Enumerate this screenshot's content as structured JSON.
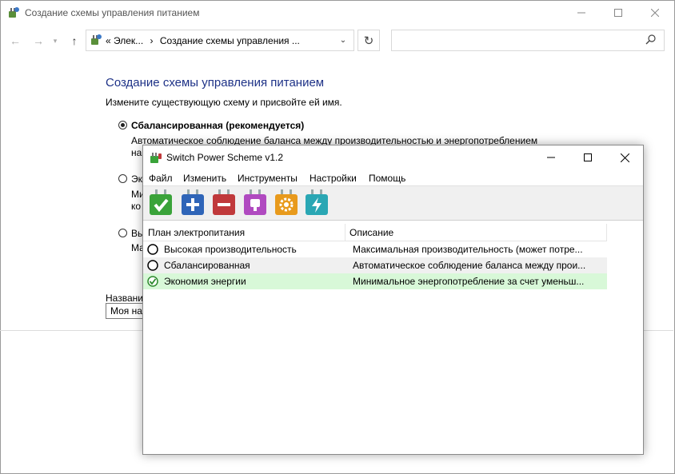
{
  "background_window": {
    "title": "Создание схемы управления питанием",
    "address_bar": {
      "chevron": "«",
      "crumb_1": "Элек...",
      "separator": "›",
      "crumb_2": "Создание схемы управления ..."
    },
    "search_placeholder": "",
    "heading": "Создание схемы управления питанием",
    "subheading": "Измените существующую схему и присвойте ей имя.",
    "options": [
      {
        "label": "Сбалансированная (рекомендуется)",
        "selected": true,
        "desc_line1": "Автоматическое соблюдение баланса между производительностью и энергопотреблением",
        "desc_line2": "на"
      },
      {
        "label": "Эк",
        "selected": false,
        "desc_line1": "Ми",
        "desc_line2": "ко"
      },
      {
        "label": "Вы",
        "selected": false,
        "desc_line1": "Ма"
      }
    ],
    "name_label": "Названи",
    "name_value": "Моя на"
  },
  "app": {
    "title": "Switch Power Scheme v1.2",
    "menu": [
      "Файл",
      "Изменить",
      "Инструменты",
      "Настройки",
      "Помощь"
    ],
    "toolbar_icons": [
      {
        "name": "activate",
        "color": "#3aa33a",
        "glyph": "check"
      },
      {
        "name": "add",
        "color": "#2f65b8",
        "glyph": "plus"
      },
      {
        "name": "remove",
        "color": "#c0393b",
        "glyph": "minus"
      },
      {
        "name": "plug",
        "color": "#b04ac0",
        "glyph": "plug"
      },
      {
        "name": "settings",
        "color": "#e89a1c",
        "glyph": "gear"
      },
      {
        "name": "power",
        "color": "#2aa7b4",
        "glyph": "bolt"
      }
    ],
    "columns": {
      "plan": "План электропитания",
      "description": "Описание"
    },
    "rows": [
      {
        "name": "Высокая производительность",
        "description": "Максимальная производительность (может потре...",
        "active": false
      },
      {
        "name": "Сбалансированная",
        "description": "Автоматическое соблюдение баланса между прои...",
        "active": false
      },
      {
        "name": "Экономия энергии",
        "description": "Минимальное энергопотребление за счет уменьш...",
        "active": true
      }
    ],
    "colors": {
      "active_row": "#d8f8d8",
      "active_check": "#2e8b2e",
      "heading_blue": "#1e3287"
    }
  }
}
